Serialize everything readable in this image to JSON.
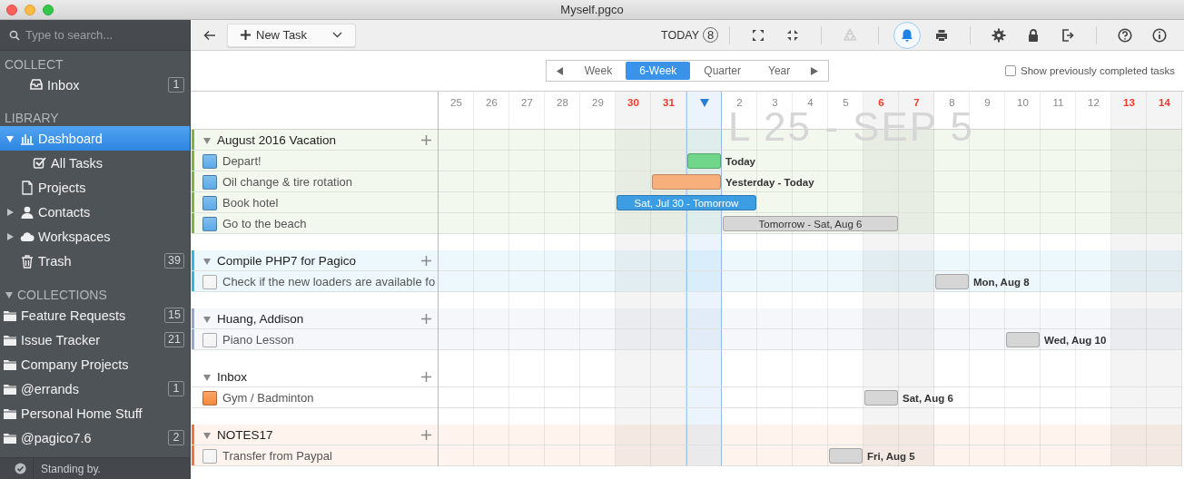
{
  "window": {
    "title": "Myself.pgco"
  },
  "sidebar": {
    "search": {
      "placeholder": "Type to search..."
    },
    "collect": {
      "title": "COLLECT",
      "items": [
        {
          "label": "Inbox",
          "count": "1",
          "selected": false
        }
      ]
    },
    "library": {
      "title": "LIBRARY",
      "items": [
        {
          "label": "Dashboard",
          "selected": true,
          "expanded": true,
          "children": [
            {
              "label": "All Tasks",
              "selected": false
            }
          ]
        },
        {
          "label": "Projects",
          "selected": false
        },
        {
          "label": "Contacts",
          "selected": false,
          "expanded": false
        },
        {
          "label": "Workspaces",
          "selected": false,
          "expanded": false
        },
        {
          "label": "Trash",
          "selected": false,
          "count": "39"
        }
      ]
    },
    "collections": {
      "title": "COLLECTIONS",
      "expanded": true,
      "items": [
        {
          "label": "Feature Requests",
          "count": "15",
          "selected": false
        },
        {
          "label": "Issue Tracker",
          "count": "21",
          "selected": false
        },
        {
          "label": "Company Projects",
          "selected": false
        },
        {
          "label": "@errands",
          "count": "1",
          "selected": false
        },
        {
          "label": "Personal Home Stuff",
          "selected": false
        },
        {
          "label": "@pagico7.6",
          "count": "2",
          "selected": false
        }
      ]
    }
  },
  "status_bar": {
    "text": "Standing by."
  },
  "toolbar": {
    "new_task": "New Task",
    "today": {
      "label": "TODAY",
      "count": "8"
    },
    "button_groups": [
      [
        {
          "kind": "expand",
          "disabled": false,
          "active": false
        },
        {
          "kind": "collapse",
          "disabled": false,
          "active": false
        }
      ],
      [
        {
          "kind": "recycle",
          "disabled": true,
          "active": false
        }
      ],
      [
        {
          "kind": "bell",
          "disabled": false,
          "active": true
        },
        {
          "kind": "print",
          "disabled": false,
          "active": false
        }
      ],
      [
        {
          "kind": "settings",
          "disabled": false,
          "active": false
        },
        {
          "kind": "lock",
          "disabled": false,
          "active": false
        },
        {
          "kind": "exit",
          "disabled": false,
          "active": false
        }
      ],
      [
        {
          "kind": "help",
          "disabled": false,
          "active": false
        },
        {
          "kind": "info",
          "disabled": false,
          "active": false
        }
      ]
    ]
  },
  "view_switcher": {
    "tabs": [
      {
        "label": "Week",
        "selected": false
      },
      {
        "label": "6-Week",
        "selected": true
      },
      {
        "label": "Quarter",
        "selected": false
      },
      {
        "label": "Year",
        "selected": false
      }
    ],
    "show_completed": {
      "label": "Show previously completed tasks",
      "checked": false
    }
  },
  "timeline": {
    "range_label": "L 25 - SEP 5",
    "days": [
      {
        "label": "25",
        "weekend": false,
        "today": false
      },
      {
        "label": "26",
        "weekend": false,
        "today": false
      },
      {
        "label": "27",
        "weekend": false,
        "today": false
      },
      {
        "label": "28",
        "weekend": false,
        "today": false
      },
      {
        "label": "29",
        "weekend": false,
        "today": false
      },
      {
        "label": "30",
        "weekend": true,
        "today": false
      },
      {
        "label": "31",
        "weekend": true,
        "today": false
      },
      {
        "weekend": false,
        "today": true
      },
      {
        "label": "2",
        "weekend": false,
        "today": false
      },
      {
        "label": "3",
        "weekend": false,
        "today": false
      },
      {
        "label": "4",
        "weekend": false,
        "today": false
      },
      {
        "label": "5",
        "weekend": false,
        "today": false
      },
      {
        "label": "6",
        "weekend": true,
        "today": false
      },
      {
        "label": "7",
        "weekend": true,
        "today": false
      },
      {
        "label": "8",
        "weekend": false,
        "today": false
      },
      {
        "label": "9",
        "weekend": false,
        "today": false
      },
      {
        "label": "10",
        "weekend": false,
        "today": false
      },
      {
        "label": "11",
        "weekend": false,
        "today": false
      },
      {
        "label": "12",
        "weekend": false,
        "today": false
      },
      {
        "label": "13",
        "weekend": true,
        "today": false
      },
      {
        "label": "14",
        "weekend": true,
        "today": false
      }
    ]
  },
  "groups": [
    {
      "title": "August 2016 Vacation",
      "color": "#7cb342",
      "expanded": true,
      "tasks": [
        {
          "title": "Depart!",
          "color": "#5aaae8",
          "bar": {
            "color": "#6fd68a",
            "label": "Today"
          }
        },
        {
          "title": "Oil change & tire rotation",
          "color": "#5aaae8",
          "bar": {
            "color": "#f7b07c",
            "label": "Yesterday - Today"
          }
        },
        {
          "title": "Book hotel",
          "color": "#5aaae8",
          "bar": {
            "color": "#3d9de2",
            "label": "Sat, Jul 30 - Tomorrow"
          }
        },
        {
          "title": "Go to the beach",
          "color": "#5aaae8",
          "bar": {
            "color": "#d6d6d6",
            "label": "Tomorrow - Sat, Aug 6"
          }
        }
      ]
    },
    {
      "title": "Compile PHP7 for Pagico",
      "color": "#35b6de",
      "expanded": true,
      "tasks": [
        {
          "title": "Check if the new loaders are available fo",
          "color": "#f4f4f4",
          "bar": {
            "color": "#d6d6d6",
            "label": "Mon, Aug 8"
          }
        }
      ]
    },
    {
      "title": "Huang, Addison",
      "color": "#8eaad0",
      "expanded": true,
      "tasks": [
        {
          "title": "Piano Lesson",
          "color": "#f4f4f4",
          "bar": {
            "color": "#d6d6d6",
            "label": "Wed, Aug 10"
          }
        }
      ]
    },
    {
      "title": "Inbox",
      "expanded": true,
      "tasks": [
        {
          "title": "Gym / Badminton",
          "color": "#f5883a",
          "bar": {
            "color": "#d6d6d6",
            "label": "Sat, Aug 6"
          }
        }
      ]
    },
    {
      "title": "NOTES17",
      "color": "#f27535",
      "expanded": true,
      "tasks": [
        {
          "title": "Transfer from Paypal",
          "color": "#f4f4f4",
          "bar": {
            "color": "#d6d6d6",
            "label": "Fri, Aug 5"
          }
        }
      ]
    }
  ]
}
